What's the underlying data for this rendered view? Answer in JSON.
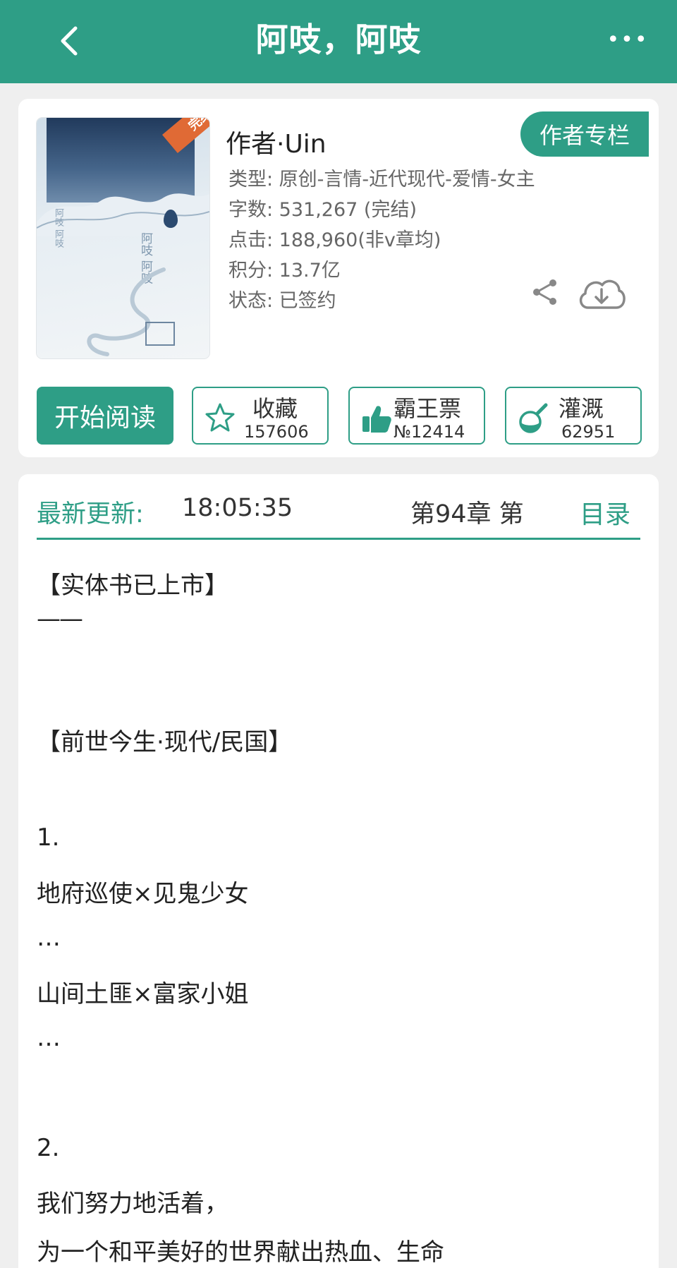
{
  "header": {
    "back_icon": "chevron-left-icon",
    "title": "阿吱，阿吱",
    "more_icon": "more-dots-icon",
    "more_label": "•••"
  },
  "book": {
    "cover_badge": "完结",
    "cover_title": "阿吱 阿吱",
    "cover_subtitle": "阿吱 阿吱",
    "author": "作者·Uin",
    "author_column_button": "作者专栏",
    "type": "类型: 原创-言情-近代现代-爱情-女主",
    "word_count": "字数: 531,267 (完结)",
    "clicks": "点击: 188,960(非v章均)",
    "score": "积分: 13.7亿",
    "status": "状态: 已签约",
    "share_icon": "share-icon",
    "download_icon": "cloud-download-icon"
  },
  "actions": {
    "start_reading": "开始阅读",
    "favorite_label": "收藏",
    "favorite_count": "157606",
    "favorite_icon": "star-icon",
    "vote_label": "霸王票",
    "vote_count": "№12414",
    "vote_icon": "thumbs-up-icon",
    "water_label": "灌溉",
    "water_count": "62951",
    "water_icon": "watering-flask-icon"
  },
  "update": {
    "label": "最新更新:",
    "time": "18:05:35",
    "chapter": "第94章  第",
    "toc": "目录"
  },
  "description": {
    "line1": "【实体书已上市】",
    "line2": "——",
    "line3": "【前世今生·现代/民国】",
    "line4": "1.",
    "line5": "地府巡使×见鬼少女",
    "line6": "…",
    "line7": "山间土匪×富家小姐",
    "line8": "…",
    "line9": "2.",
    "line10": "我们努力地活着，",
    "line11": "为一个和平美好的世界献出热血、生命"
  },
  "colors": {
    "accent": "#2e9e86",
    "background": "#efefef",
    "badge": "#e06a35"
  }
}
